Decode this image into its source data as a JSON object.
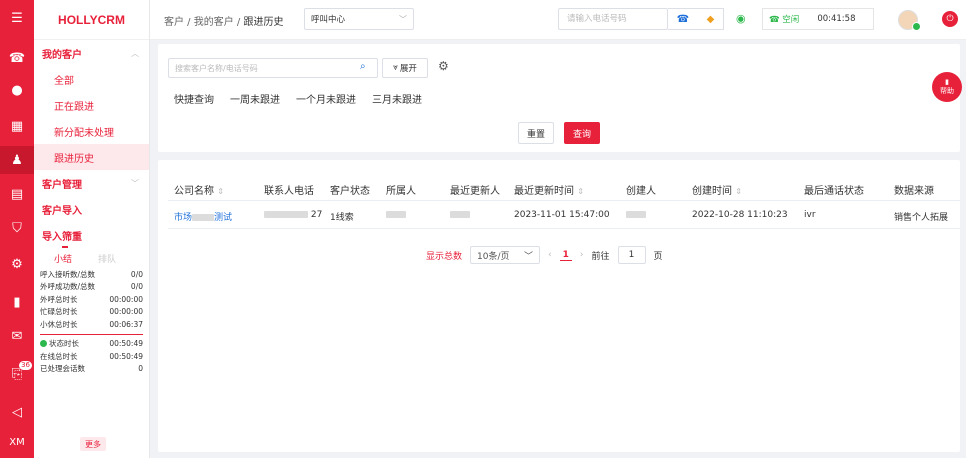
{
  "app": {
    "brand": "HOLLYCRM"
  },
  "rail": {
    "badge": "36",
    "footer": "XM"
  },
  "menu": {
    "group1": "我的客户",
    "items": [
      "全部",
      "正在跟进",
      "新分配未处理",
      "跟进历史"
    ],
    "group2": "客户管理",
    "group3": "客户导入",
    "group4": "导入筛重"
  },
  "stats": {
    "tab_on": "小结",
    "tab_off": "排队",
    "rows": [
      {
        "label": "呼入接听数/总数",
        "value": "0/0"
      },
      {
        "label": "外呼成功数/总数",
        "value": "0/0"
      },
      {
        "label": "外呼总时长",
        "value": "00:00:00"
      },
      {
        "label": "忙碌总时长",
        "value": "00:00:00"
      },
      {
        "label": "小休总时长",
        "value": "00:06:37"
      }
    ],
    "rows2": [
      {
        "label": "状态时长",
        "value": "00:50:49"
      },
      {
        "label": "在线总时长",
        "value": "00:50:49"
      },
      {
        "label": "已处理会话数",
        "value": "0"
      }
    ],
    "more": "更多"
  },
  "header": {
    "crumb1": "客户",
    "crumb2": "我的客户",
    "crumb3": "跟进历史",
    "channel": "呼叫中心",
    "phone_placeholder": "请输入电话号码",
    "status": "空闲",
    "timer": "00:41:58"
  },
  "search": {
    "placeholder": "搜索客户名称/电话号码",
    "expand": "展开",
    "quick_label": "快捷查询",
    "quick_items": [
      "一周未跟进",
      "一个月未跟进",
      "三月未跟进"
    ],
    "reset": "重置",
    "query": "查询"
  },
  "help": {
    "label": "帮助"
  },
  "table": {
    "headers": [
      "公司名称",
      "联系人电话",
      "客户状态",
      "所属人",
      "最近更新人",
      "最近更新时间",
      "创建人",
      "创建时间",
      "最后通话状态",
      "数据来源"
    ],
    "row": {
      "company_a": "市场",
      "company_b": "测试",
      "phone_tail": "27",
      "status": "1线索",
      "updated_at": "2023-11-01 15:47:00",
      "created_at": "2022-10-28 11:10:23",
      "call_status": "ivr",
      "source": "销售个人拓展"
    }
  },
  "pager": {
    "total": "显示总数",
    "size": "10条/页",
    "current": "1",
    "goto": "前往",
    "goto_value": "1",
    "unit": "页"
  }
}
